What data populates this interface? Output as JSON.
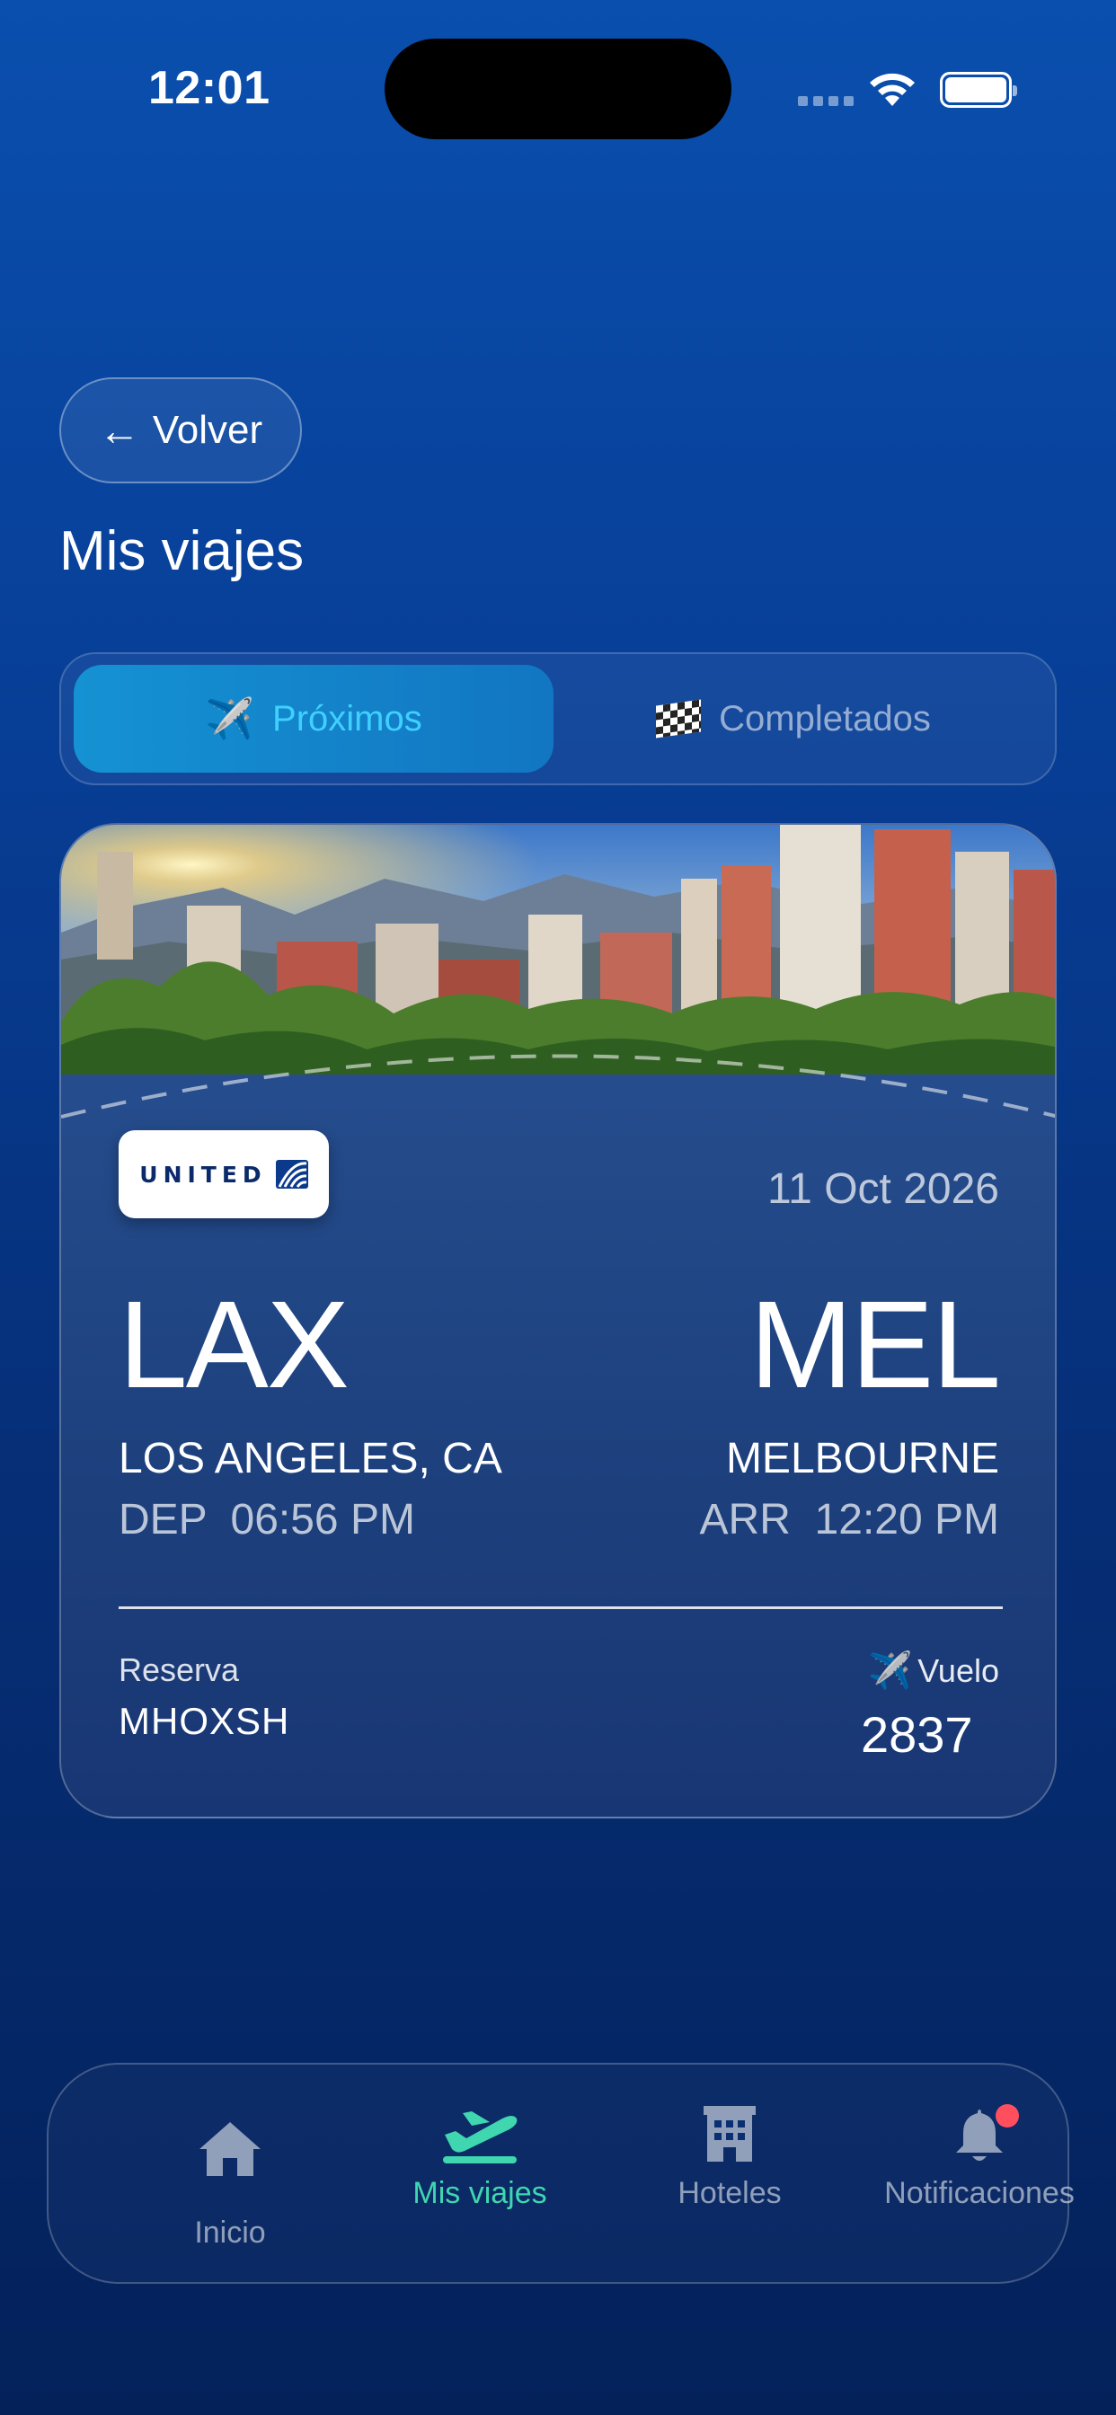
{
  "status_bar": {
    "time": "12:01"
  },
  "back_button": {
    "label": "Volver",
    "arrow": "←"
  },
  "page_title": "Mis viajes",
  "tabs": [
    {
      "label": "Próximos",
      "icon": "airplane-icon",
      "emoji": "✈️",
      "active": true
    },
    {
      "label": "Completados",
      "icon": "checkered-flag-icon",
      "active": false
    }
  ],
  "trip": {
    "airline": "UNITED",
    "date": "11 Oct 2026",
    "origin": {
      "code": "LAX",
      "city": "LOS ANGELES, CA",
      "time": "DEP  06:56 PM"
    },
    "destination": {
      "code": "MEL",
      "city": "MELBOURNE",
      "time": "ARR  12:20 PM"
    },
    "booking": {
      "label": "Reserva",
      "code": "MHOXSH"
    },
    "flight": {
      "label": "Vuelo",
      "emoji": "✈️",
      "number": "2837"
    }
  },
  "bottom_nav": [
    {
      "label": "Inicio",
      "icon": "home-icon",
      "active": false
    },
    {
      "label": "Mis viajes",
      "icon": "airplane-departure-icon",
      "active": true
    },
    {
      "label": "Hoteles",
      "icon": "hotel-icon",
      "active": false
    },
    {
      "label": "Notificaciones",
      "icon": "bell-icon",
      "active": false,
      "badge": true
    }
  ],
  "colors": {
    "background_top": "#0a4fae",
    "background_bottom": "#04215a",
    "tab_active": "#1592d3",
    "tab_active_text": "#3ed0ff",
    "nav_active": "#3fd6b0",
    "badge": "#ff4f5e"
  }
}
